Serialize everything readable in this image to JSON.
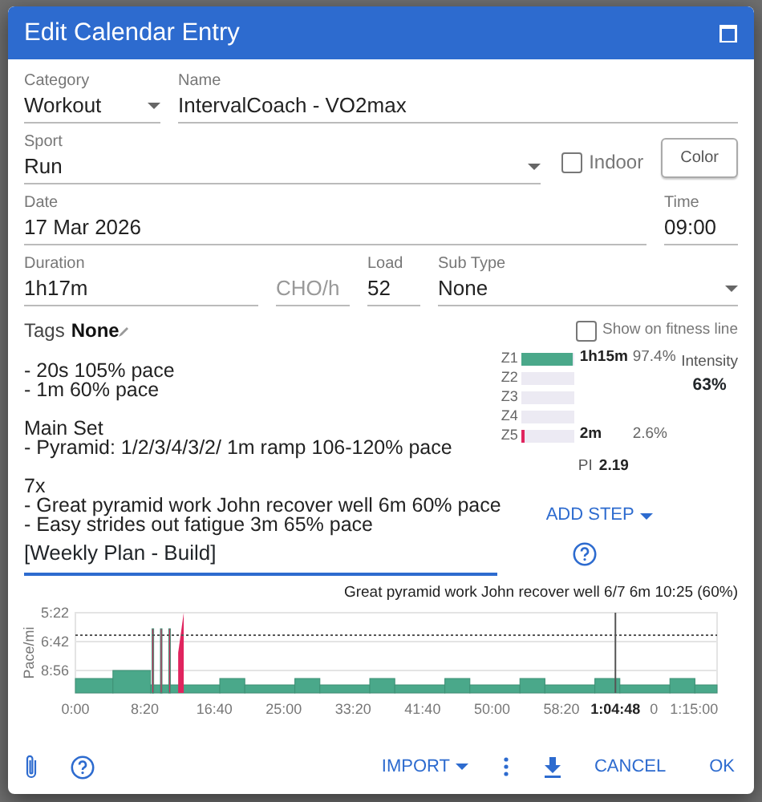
{
  "dialog": {
    "title": "Edit Calendar Entry"
  },
  "fields": {
    "category": {
      "label": "Category",
      "value": "Workout"
    },
    "name": {
      "label": "Name",
      "value": "IntervalCoach - VO2max"
    },
    "sport": {
      "label": "Sport",
      "value": "Run"
    },
    "indoor": {
      "label": "Indoor",
      "checked": false
    },
    "color_button": "Color",
    "date": {
      "label": "Date",
      "value": "17 Mar 2026"
    },
    "time": {
      "label": "Time",
      "value": "09:00"
    },
    "duration": {
      "label": "Duration",
      "value": "1h17m"
    },
    "cho": {
      "placeholder": "CHO/h"
    },
    "load": {
      "label": "Load",
      "value": "52"
    },
    "sub_type": {
      "label": "Sub Type",
      "value": "None"
    }
  },
  "tags": {
    "label": "Tags",
    "value": "None"
  },
  "show_on_fitness_line": {
    "label": "Show on fitness line",
    "checked": false
  },
  "description": [
    [
      "- 20s 105% pace",
      "- 1m 60% pace"
    ],
    [
      "Main Set",
      "- Pyramid: 1/2/3/4/3/2/ 1m ramp 106-120% pace"
    ],
    [
      "7x",
      "- Great pyramid work John recover well 6m 60% pace",
      "- Easy strides out fatigue 3m 65% pace"
    ]
  ],
  "zones": [
    {
      "name": "Z1",
      "level": 0.974,
      "color": "#4aa88a",
      "time": "1h15m",
      "percent": "97.4%"
    },
    {
      "name": "Z2"
    },
    {
      "name": "Z3"
    },
    {
      "name": "Z4"
    },
    {
      "name": "Z5",
      "level": 0.03,
      "color": "#e0245e",
      "time": "2m",
      "percent": "2.6%"
    }
  ],
  "intensity": {
    "label": "Intensity",
    "value": "63%"
  },
  "pi": {
    "label": "PI",
    "value": "2.19"
  },
  "add_step": "ADD STEP",
  "plan": {
    "value": "[Weekly Plan - Build]"
  },
  "chart": {
    "caption": "Great pyramid work John recover well 6/7 6m 10:25 (60%)",
    "y_title": "Pace/mi",
    "y_ticks": [
      "5:22",
      "6:42",
      "8:56"
    ],
    "x_ticks": [
      "0:00",
      "8:20",
      "16:40",
      "25:00",
      "33:20",
      "41:40",
      "50:00",
      "58:20"
    ],
    "cursor_label": "1:04:48",
    "cursor_value": "0",
    "end_tick": "1:15:00"
  },
  "footer": {
    "import": "IMPORT",
    "cancel": "CANCEL",
    "ok": "OK"
  }
}
